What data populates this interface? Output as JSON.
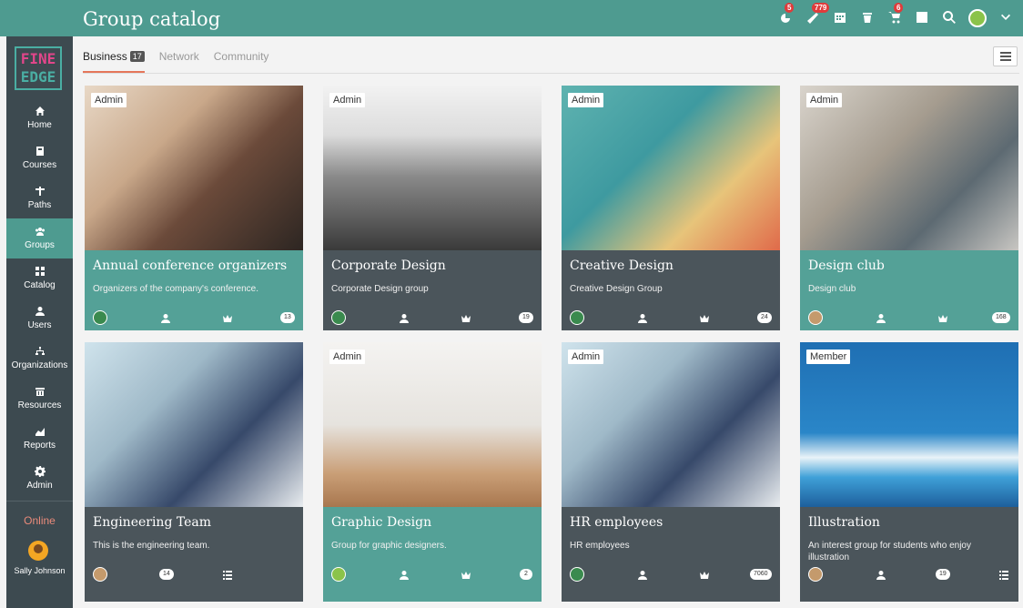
{
  "header": {
    "title": "Group catalog",
    "badges": {
      "notifications": "5",
      "alerts": "779",
      "cart": "6"
    }
  },
  "sidebar": {
    "logo_top": "FINE",
    "logo_bottom": "EDGE",
    "items": [
      {
        "label": "Home",
        "icon": "home-icon"
      },
      {
        "label": "Courses",
        "icon": "book-icon"
      },
      {
        "label": "Paths",
        "icon": "signpost-icon"
      },
      {
        "label": "Groups",
        "icon": "users-icon"
      },
      {
        "label": "Catalog",
        "icon": "grid-icon"
      },
      {
        "label": "Users",
        "icon": "user-icon"
      },
      {
        "label": "Organizations",
        "icon": "org-icon"
      },
      {
        "label": "Resources",
        "icon": "resources-icon"
      },
      {
        "label": "Reports",
        "icon": "chart-icon"
      },
      {
        "label": "Admin",
        "icon": "gear-icon"
      }
    ],
    "status": "Online",
    "user_name": "Sally Johnson"
  },
  "tabs": [
    {
      "label": "Business",
      "count": "17"
    },
    {
      "label": "Network"
    },
    {
      "label": "Community"
    }
  ],
  "cards": [
    {
      "title": "Annual conference organizers",
      "desc": "Organizers of the company's conference.",
      "role": "Admin",
      "count": "13",
      "theme": "teal"
    },
    {
      "title": "Corporate Design",
      "desc": "Corporate Design group",
      "role": "Admin",
      "count": "19",
      "theme": "dark"
    },
    {
      "title": "Creative Design",
      "desc": "Creative Design Group",
      "role": "Admin",
      "count": "24",
      "theme": "dark"
    },
    {
      "title": "Design club",
      "desc": "Design club",
      "role": "Admin",
      "count": "168",
      "theme": "teal"
    },
    {
      "title": "Engineering Team",
      "desc": "This is the engineering team.",
      "role": "",
      "count": "14",
      "theme": "dark"
    },
    {
      "title": "Graphic Design",
      "desc": "Group for graphic designers.",
      "role": "Admin",
      "count": "2",
      "theme": "teal"
    },
    {
      "title": "HR employees",
      "desc": "HR employees",
      "role": "Admin",
      "count": "7060",
      "theme": "dark"
    },
    {
      "title": "Illustration",
      "desc": "An interest group for students who enjoy illustration",
      "role": "Member",
      "count": "19",
      "theme": "dark"
    }
  ]
}
